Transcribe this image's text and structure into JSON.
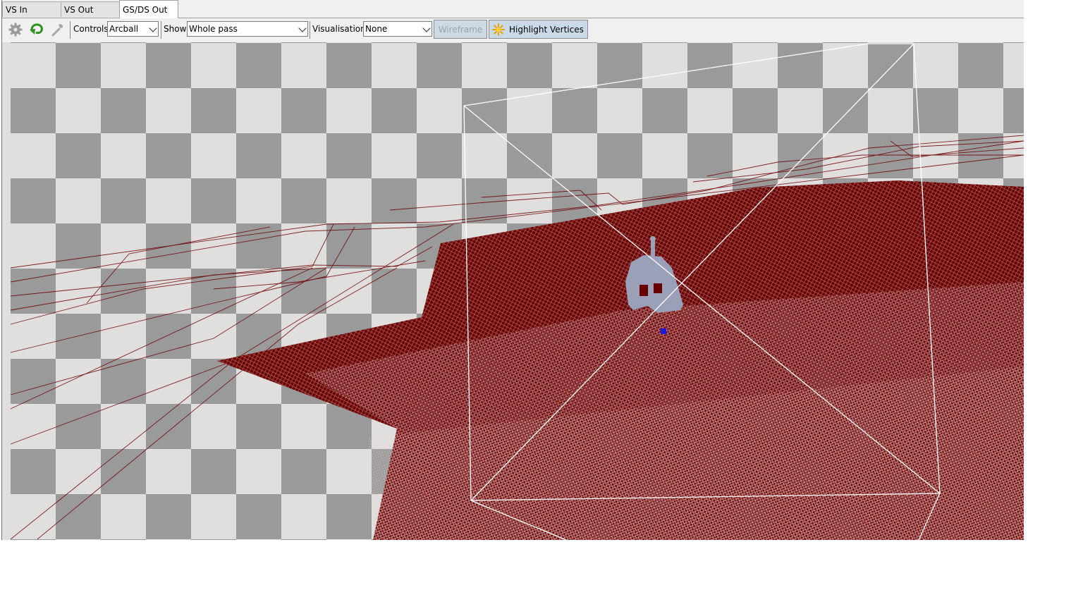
{
  "tabs": [
    {
      "label": "VS In",
      "active": false
    },
    {
      "label": "VS Out",
      "active": false
    },
    {
      "label": "GS/DS Out",
      "active": true
    }
  ],
  "toolbar": {
    "controls_label": "Controls",
    "controls_value": "Arcball",
    "show_label": "Show",
    "show_value": "Whole pass",
    "visualisation_label": "Visualisation",
    "visualisation_value": "None",
    "wireframe_label": "Wireframe",
    "highlight_label": "Highlight Vertices",
    "icons": [
      "gear-icon",
      "reset-arrow-icon",
      "wrench-icon",
      "highlight-star-icon"
    ]
  },
  "viewport": {
    "checker_dark": "#9a9a9a",
    "checker_light": "#e0dfde",
    "mesh_color": "#6b0000",
    "bbox_color": "#ffffff",
    "model_color": "#9aa0b8",
    "vertex_highlight_color": "#1a1ae6"
  }
}
